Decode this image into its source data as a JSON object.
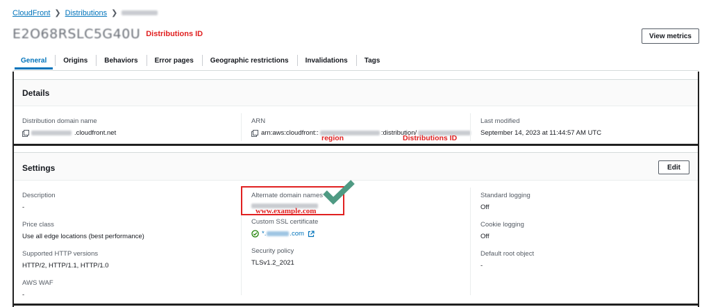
{
  "breadcrumb": {
    "service": "CloudFront",
    "section": "Distributions"
  },
  "title": {
    "id_text": "E2O68RSLC5G40U",
    "annotation": "Distributions ID"
  },
  "header": {
    "view_metrics": "View metrics"
  },
  "tabs": [
    {
      "label": "General",
      "active": true
    },
    {
      "label": "Origins"
    },
    {
      "label": "Behaviors"
    },
    {
      "label": "Error pages"
    },
    {
      "label": "Geographic restrictions"
    },
    {
      "label": "Invalidations"
    },
    {
      "label": "Tags"
    }
  ],
  "details": {
    "title": "Details",
    "domain_label": "Distribution domain name",
    "domain_suffix": ".cloudfront.net",
    "arn_label": "ARN",
    "arn_prefix": "arn:aws:cloudfront::",
    "arn_mid": ":distribution/",
    "last_modified_label": "Last modified",
    "last_modified_value": "September 14, 2023 at 11:44:57 AM UTC",
    "annot_region": "region",
    "annot_dist_id": "Distributions ID"
  },
  "settings": {
    "title": "Settings",
    "edit": "Edit",
    "col1": [
      {
        "label": "Description",
        "value": "-"
      },
      {
        "label": "Price class",
        "value": "Use all edge locations (best performance)"
      },
      {
        "label": "Supported HTTP versions",
        "value": "HTTP/2, HTTP/1.1, HTTP/1.0"
      },
      {
        "label": "AWS WAF",
        "value": "-"
      }
    ],
    "alt_domain_label": "Alternate domain names",
    "alt_domain_annotation": "www.example.com",
    "ssl_label": "Custom SSL certificate",
    "ssl_prefix": "*.",
    "ssl_suffix": ".com",
    "security_policy_label": "Security policy",
    "security_policy_value": "TLSv1.2_2021",
    "col3": [
      {
        "label": "Standard logging",
        "value": "Off"
      },
      {
        "label": "Cookie logging",
        "value": "Off"
      },
      {
        "label": "Default root object",
        "value": "-"
      }
    ]
  },
  "colors": {
    "link": "#0073bb",
    "annotation_red": "#e02020",
    "check_green": "#4f9a83",
    "ok_green": "#1d8102"
  }
}
